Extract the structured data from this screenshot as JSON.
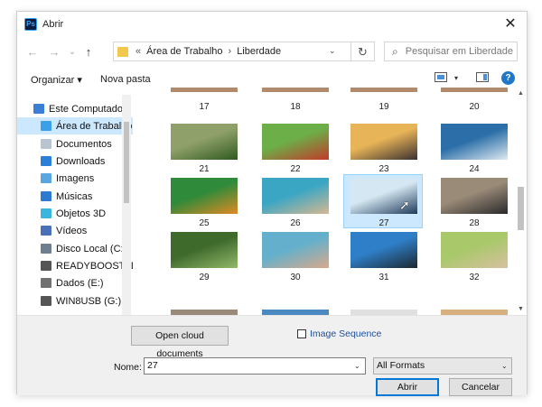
{
  "window": {
    "title": "Abrir",
    "app_badge": "Ps",
    "close_glyph": "✕"
  },
  "address": {
    "back_glyph": "←",
    "forward_glyph": "→",
    "dropdown_glyph": "⌄",
    "up_glyph": "↑",
    "chevrons": "«",
    "segments": [
      "Área de Trabalho",
      "Liberdade"
    ],
    "separator": "›",
    "refresh_glyph": "↻"
  },
  "search": {
    "placeholder": "Pesquisar em Liberdade",
    "glyph": "⌕"
  },
  "toolbar": {
    "organize_label": "Organizar ▾",
    "new_folder_label": "Nova pasta",
    "help_glyph": "?",
    "view_dd": "▾"
  },
  "nav": {
    "items": [
      {
        "label": "Este Computador",
        "icon": "computer-icon",
        "color": "#3a7fd5",
        "selected": false
      },
      {
        "label": "Área de Trabalho",
        "icon": "desktop-icon",
        "color": "#3aa0e8",
        "selected": true
      },
      {
        "label": "Documentos",
        "icon": "documents-icon",
        "color": "#b8c4d0",
        "selected": false
      },
      {
        "label": "Downloads",
        "icon": "download-icon",
        "color": "#2b7fd8",
        "selected": false
      },
      {
        "label": "Imagens",
        "icon": "pictures-icon",
        "color": "#5aa6e0",
        "selected": false
      },
      {
        "label": "Músicas",
        "icon": "music-icon",
        "color": "#2e7ad1",
        "selected": false
      },
      {
        "label": "Objetos 3D",
        "icon": "objects-3d-icon",
        "color": "#38b6e0",
        "selected": false
      },
      {
        "label": "Vídeos",
        "icon": "videos-icon",
        "color": "#4a70b8",
        "selected": false
      },
      {
        "label": "Disco Local (C:)",
        "icon": "drive-c-icon",
        "color": "#6f7f8f",
        "selected": false
      },
      {
        "label": "READYBOOST (D",
        "icon": "usb-drive-icon",
        "color": "#555555",
        "selected": false
      },
      {
        "label": "Dados (E:)",
        "icon": "drive-e-icon",
        "color": "#707070",
        "selected": false
      },
      {
        "label": "WIN8USB (G:)",
        "icon": "usb-drive-icon",
        "color": "#555555",
        "selected": false
      }
    ]
  },
  "files": {
    "top_labels": [
      "17",
      "18",
      "19",
      "20"
    ],
    "rows": [
      [
        {
          "name": "21",
          "colors": [
            "#8fa06a",
            "#2f5a1f"
          ]
        },
        {
          "name": "22",
          "colors": [
            "#6cae48",
            "#c23a2a"
          ]
        },
        {
          "name": "23",
          "colors": [
            "#e8b458",
            "#3a3030"
          ]
        },
        {
          "name": "24",
          "colors": [
            "#2b6ea8",
            "#dfe9f1"
          ]
        }
      ],
      [
        {
          "name": "25",
          "colors": [
            "#2f8a3a",
            "#e08a24"
          ]
        },
        {
          "name": "26",
          "colors": [
            "#3aa6c4",
            "#d6b890"
          ]
        },
        {
          "name": "27",
          "colors": [
            "#d4e7f2",
            "#1f3a5a"
          ]
        },
        {
          "name": "28",
          "colors": [
            "#9a8a78",
            "#2a2a2a"
          ]
        }
      ],
      [
        {
          "name": "29",
          "colors": [
            "#3e6a2c",
            "#93b86a"
          ]
        },
        {
          "name": "30",
          "colors": [
            "#64b0cc",
            "#d9a98a"
          ]
        },
        {
          "name": "31",
          "colors": [
            "#2f7fc8",
            "#1c2830"
          ]
        },
        {
          "name": "32",
          "colors": [
            "#a8c86a",
            "#d8c0a0"
          ]
        }
      ]
    ],
    "selected_name": "27"
  },
  "bottom": {
    "cloud_button": "Open cloud documents",
    "image_sequence": "Image Sequence",
    "name_label": "Nome:",
    "name_value": "27",
    "format_value": "All Formats",
    "open_button": "Abrir",
    "cancel_button": "Cancelar",
    "dd_glyph": "⌄"
  }
}
